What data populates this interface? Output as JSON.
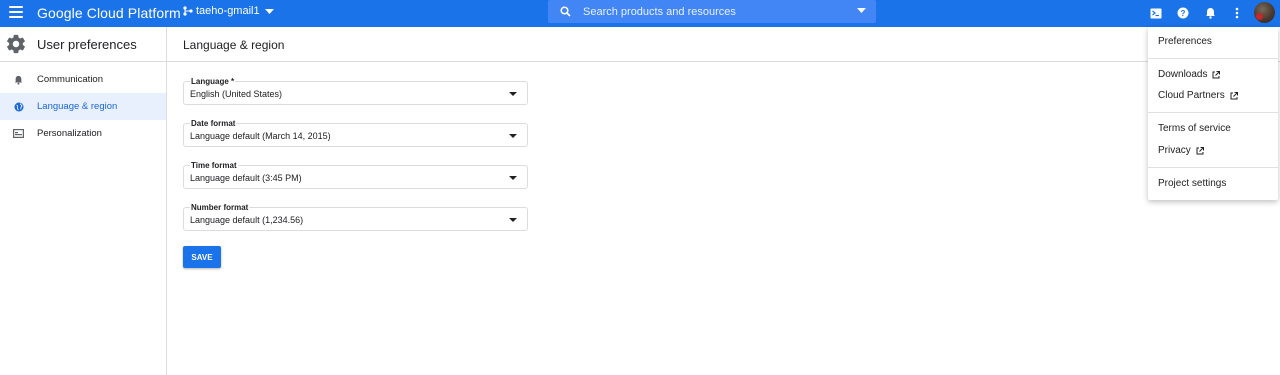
{
  "topbar": {
    "app_title": "Google Cloud Platform",
    "project_name": "taeho-gmail1",
    "search_placeholder": "Search products and resources",
    "accent_color": "#1a73e8",
    "icons": [
      "cloud-shell-icon",
      "help-icon",
      "notifications-icon",
      "more-vert-icon",
      "avatar"
    ]
  },
  "sidebar": {
    "title": "User preferences",
    "items": [
      {
        "label": "Communication",
        "icon": "bell-icon",
        "active": false
      },
      {
        "label": "Language & region",
        "icon": "globe-icon",
        "active": true
      },
      {
        "label": "Personalization",
        "icon": "card-icon",
        "active": false
      }
    ]
  },
  "main": {
    "title": "Language & region",
    "fields": [
      {
        "label": "Language *",
        "value": "English (United States)"
      },
      {
        "label": "Date format",
        "value": "Language default (March 14, 2015)"
      },
      {
        "label": "Time format",
        "value": "Language default (3:45 PM)"
      },
      {
        "label": "Number format",
        "value": "Language default (1,234.56)"
      }
    ],
    "save_label": "SAVE"
  },
  "menu": {
    "items": [
      {
        "label": "Preferences",
        "external": false
      },
      {
        "label": "Downloads",
        "external": true
      },
      {
        "label": "Cloud Partners",
        "external": true
      },
      {
        "label": "Terms of service",
        "external": false
      },
      {
        "label": "Privacy",
        "external": true
      },
      {
        "label": "Project settings",
        "external": false
      }
    ]
  }
}
